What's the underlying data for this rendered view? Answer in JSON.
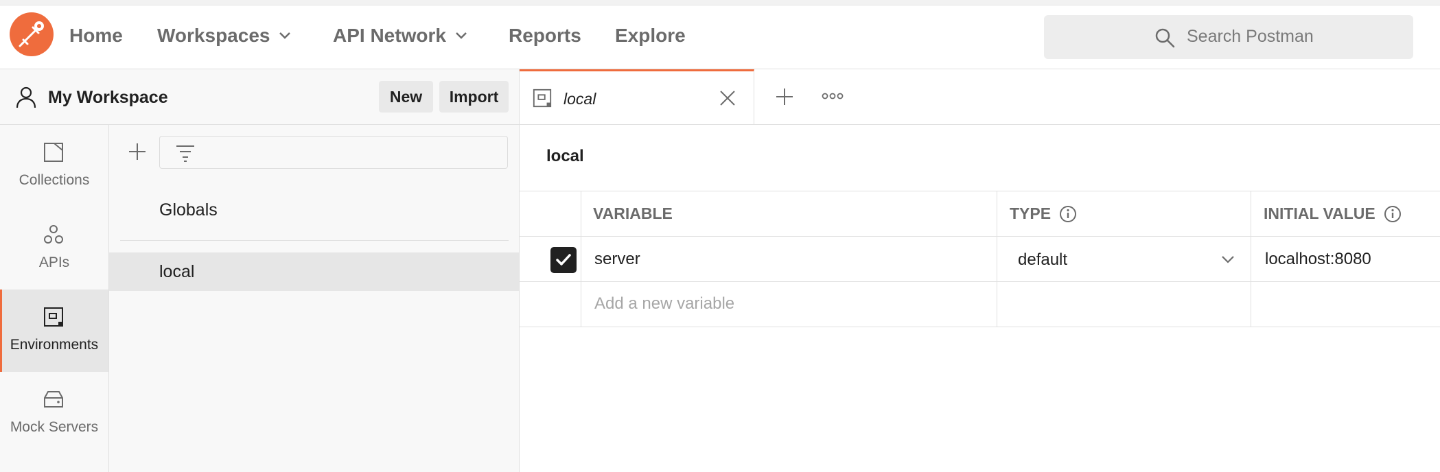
{
  "nav": {
    "home": "Home",
    "workspaces": "Workspaces",
    "api_network": "API Network",
    "reports": "Reports",
    "explore": "Explore"
  },
  "search": {
    "placeholder": "Search Postman"
  },
  "workspace": {
    "title": "My Workspace",
    "new_label": "New",
    "import_label": "Import"
  },
  "sidebar": {
    "items": [
      {
        "label": "Collections",
        "icon": "collections-icon"
      },
      {
        "label": "APIs",
        "icon": "apis-icon"
      },
      {
        "label": "Environments",
        "icon": "environments-icon",
        "active": true
      },
      {
        "label": "Mock Servers",
        "icon": "mock-servers-icon"
      }
    ]
  },
  "envlist": {
    "globals": "Globals",
    "items": [
      "local"
    ]
  },
  "tab": {
    "name": "local"
  },
  "environment": {
    "title": "local",
    "columns": {
      "variable": "VARIABLE",
      "type": "TYPE",
      "initial_value": "INITIAL VALUE"
    },
    "rows": [
      {
        "checked": true,
        "variable": "server",
        "type": "default",
        "initial_value": "localhost:8080"
      }
    ],
    "new_variable_placeholder": "Add a new variable"
  },
  "colors": {
    "accent": "#ef6c3d",
    "text": "#212121",
    "muted": "#6b6b6b"
  }
}
